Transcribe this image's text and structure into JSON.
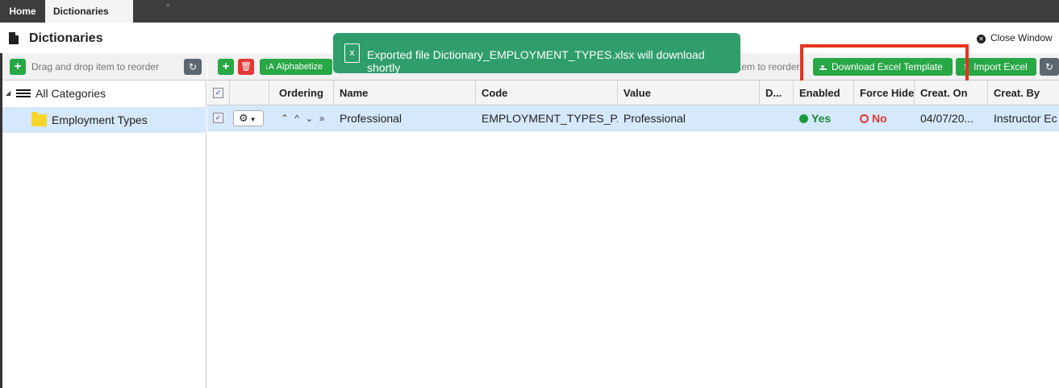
{
  "tabs": [
    {
      "label": "Home"
    },
    {
      "label": "Dictionaries",
      "close": "×"
    }
  ],
  "header": {
    "title": "Dictionaries",
    "close_label": "Close Window"
  },
  "left": {
    "drag_placeholder": "Drag and drop item to reorder",
    "tree": [
      {
        "label": "All Categories"
      },
      {
        "label": "Employment Types",
        "selected": true
      }
    ]
  },
  "toolbar": {
    "alphabetize_label": "Alphabetize",
    "reorder_hint": "tem to reorder",
    "download_label": "Download Excel Template",
    "import_label": "Import Excel"
  },
  "toast": {
    "message": "Exported file Dictionary_EMPLOYMENT_TYPES.xlsx will download shortly"
  },
  "grid": {
    "columns": [
      "Ordering",
      "Name",
      "Code",
      "Value",
      "D...",
      "Enabled",
      "Force Hide",
      "Creat. On",
      "Creat. By"
    ],
    "rows": [
      {
        "name": "Professional",
        "code": "EMPLOYMENT_TYPES_P...",
        "value": "Professional",
        "enabled": "Yes",
        "force_hide": "No",
        "created_on": "04/07/20...",
        "created_by": "Instructor Ec"
      }
    ]
  },
  "colors": {
    "accent_green": "#28a745",
    "toast_green": "#2f9e6b",
    "danger_red": "#e53935",
    "selection_blue": "#d6e8fb",
    "highlight_red": "#e8321e"
  },
  "icons": [
    "document-icon",
    "close-icon",
    "plus-icon",
    "refresh-icon",
    "list-icon",
    "folder-icon",
    "trash-icon",
    "sort-az-icon",
    "download-icon",
    "upload-icon",
    "excel-file-icon",
    "gear-icon",
    "move-top-icon",
    "move-up-icon",
    "move-down-icon",
    "move-bottom-icon"
  ]
}
